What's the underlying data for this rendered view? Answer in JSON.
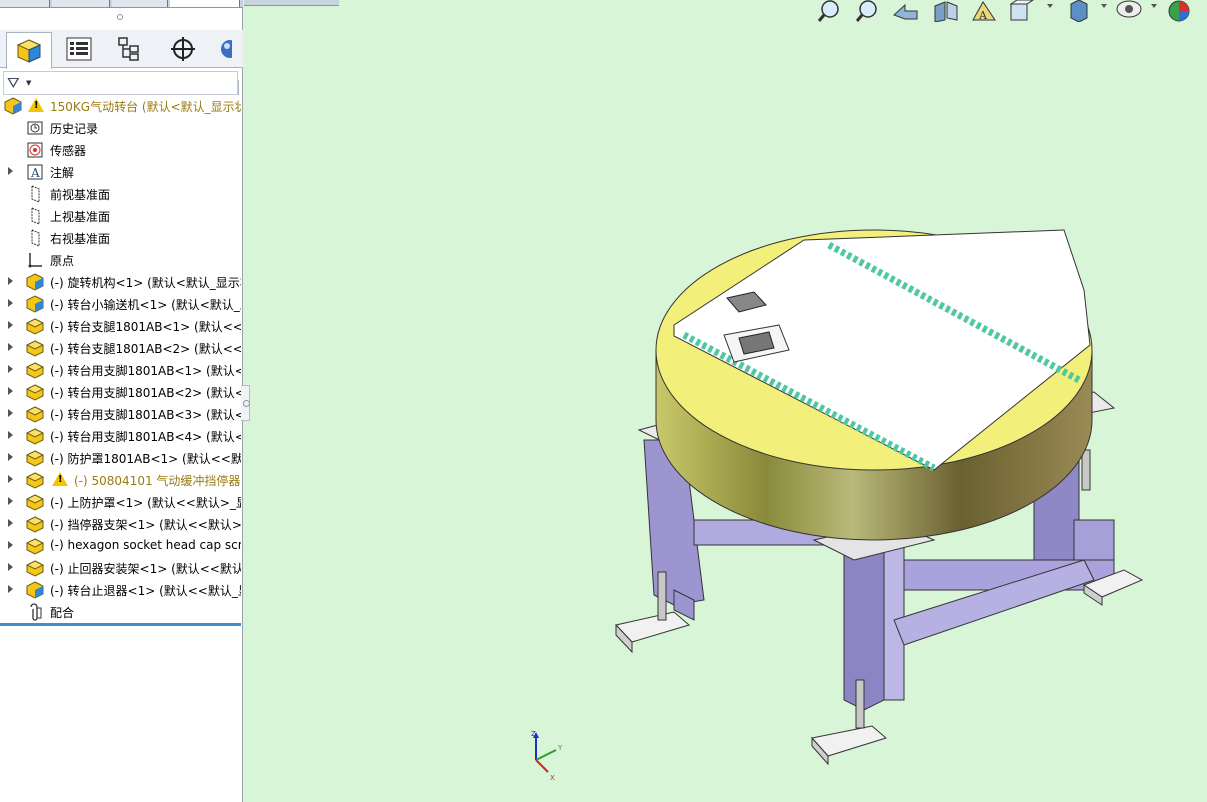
{
  "feature_tree": {
    "root": {
      "label": "150KG气动转台 (默认<默认_显示状"
    },
    "items": [
      {
        "label": "历史记录",
        "icon": "history-icon",
        "expandable": false
      },
      {
        "label": "传感器",
        "icon": "sensor-icon",
        "expandable": false
      },
      {
        "label": "注解",
        "icon": "annotation-icon",
        "expandable": true
      },
      {
        "label": "前视基准面",
        "icon": "plane-icon",
        "expandable": false
      },
      {
        "label": "上视基准面",
        "icon": "plane-icon",
        "expandable": false
      },
      {
        "label": "右视基准面",
        "icon": "plane-icon",
        "expandable": false
      },
      {
        "label": "原点",
        "icon": "origin-icon",
        "expandable": false
      },
      {
        "label": "(-) 旋转机构<1> (默认<默认_显示状",
        "icon": "subassembly-icon",
        "expandable": true
      },
      {
        "label": "(-) 转台小输送机<1> (默认<默认_显",
        "icon": "subassembly-icon",
        "expandable": true
      },
      {
        "label": "(-) 转台支腿1801AB<1> (默认<<默",
        "icon": "part-icon",
        "expandable": true
      },
      {
        "label": "(-) 转台支腿1801AB<2> (默认<<默",
        "icon": "part-icon",
        "expandable": true
      },
      {
        "label": "(-) 转台用支脚1801AB<1> (默认<<",
        "icon": "part-icon",
        "expandable": true
      },
      {
        "label": "(-) 转台用支脚1801AB<2> (默认<<",
        "icon": "part-icon",
        "expandable": true
      },
      {
        "label": "(-) 转台用支脚1801AB<3> (默认<<",
        "icon": "part-icon",
        "expandable": true
      },
      {
        "label": "(-) 转台用支脚1801AB<4> (默认<<",
        "icon": "part-icon",
        "expandable": true
      },
      {
        "label": "(-) 防护罩1801AB<1> (默认<<默认",
        "icon": "part-icon",
        "expandable": true
      },
      {
        "label": "(-) 50804101 气动缓冲挡停器",
        "icon": "part-icon",
        "expandable": true,
        "warning": true
      },
      {
        "label": "(-) 上防护罩<1> (默认<<默认>_显",
        "icon": "part-icon",
        "expandable": true
      },
      {
        "label": "(-) 挡停器支架<1> (默认<<默认>_",
        "icon": "part-icon",
        "expandable": true
      },
      {
        "label": "(-) hexagon socket head cap scre",
        "icon": "part-icon",
        "expandable": true
      },
      {
        "label": "(-) 止回器安装架<1> (默认<<默认",
        "icon": "part-icon",
        "expandable": true
      },
      {
        "label": "(-) 转台止退器<1> (默认<<默认_显示",
        "icon": "subassembly-icon",
        "expandable": true
      },
      {
        "label": "配合",
        "icon": "mates-icon",
        "expandable": false
      }
    ]
  },
  "manager_tabs": [
    "feature-manager",
    "property-manager",
    "configuration-manager",
    "dimxpert-manager",
    "display-manager"
  ],
  "view_toolbar": [
    "zoom-to-fit-icon",
    "zoom-to-area-icon",
    "previous-view-icon",
    "section-view-icon",
    "dynamic-annotation-icon",
    "view-orientation-icon",
    "display-style-icon",
    "hide-show-icon",
    "appearance-icon"
  ],
  "triad": {
    "z": "Z",
    "y": "Y",
    "x": "X"
  },
  "colors": {
    "viewport_bg": "#d8f5d8",
    "tabletop": "#f2f07a",
    "frame": "#9c95cf",
    "tree_warning": "#9a7b10"
  }
}
